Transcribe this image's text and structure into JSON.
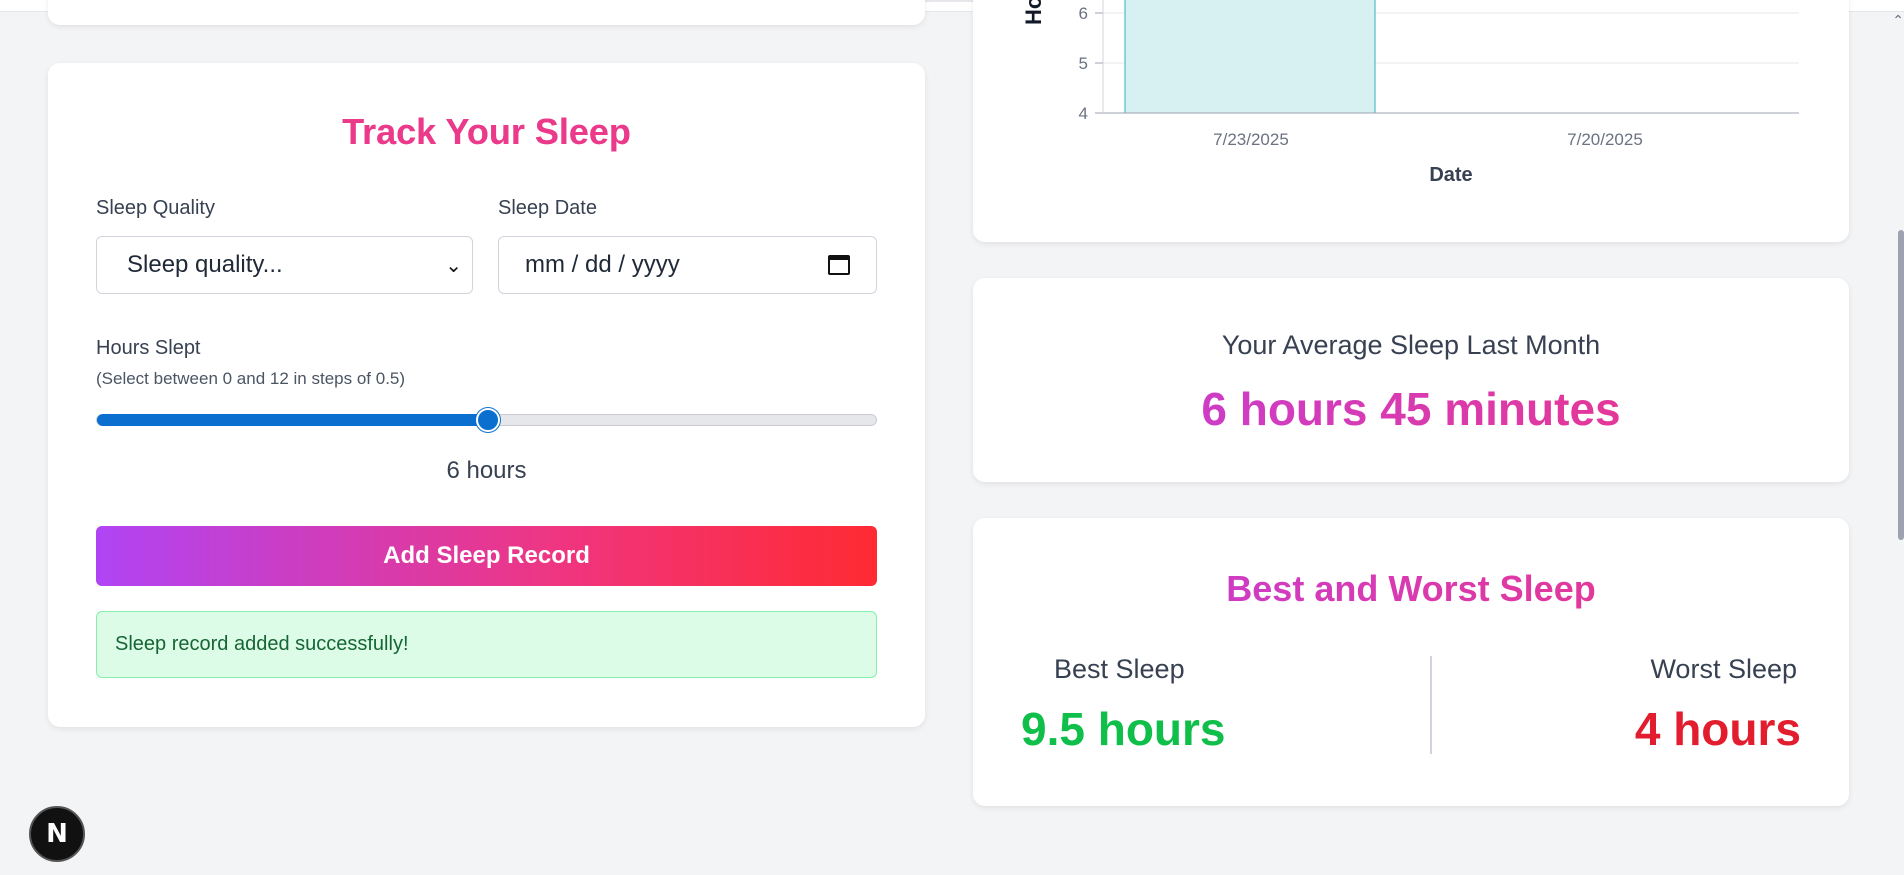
{
  "form": {
    "title": "Track Your Sleep",
    "quality_label": "Sleep Quality",
    "quality_placeholder": "Sleep quality...",
    "date_label": "Sleep Date",
    "date_placeholder": "mm / dd / yyyy",
    "hours_label": "Hours Slept",
    "hours_hint": "(Select between 0 and 12 in steps of 0.5)",
    "hours_value": 6,
    "hours_min": 0,
    "hours_max": 12,
    "hours_display": "6 hours",
    "submit_label": "Add Sleep Record",
    "success_message": "Sleep record added successfully!"
  },
  "chart": {
    "chart_data": {
      "type": "bar",
      "categories": [
        "7/23/2025",
        "7/20/2025"
      ],
      "y_ticks": [
        "4",
        "5",
        "6"
      ],
      "ylabel_visible_fragment": "Ho",
      "xlabel": "Date",
      "visible_bar": {
        "category": "7/23/2025",
        "value_at_least": 6
      },
      "bar_color": "#d7f0f2",
      "bar_stroke": "#2bb3b8"
    }
  },
  "average": {
    "title": "Your Average Sleep Last Month",
    "value": "6 hours 45 minutes"
  },
  "best_worst": {
    "title": "Best and Worst Sleep",
    "best_label": "Best Sleep",
    "best_value": "9.5 hours",
    "worst_label": "Worst Sleep",
    "worst_value": "4 hours",
    "best_color": "#0fbf4a",
    "worst_color": "#e11d2e"
  },
  "badge": {
    "letter": "N"
  }
}
